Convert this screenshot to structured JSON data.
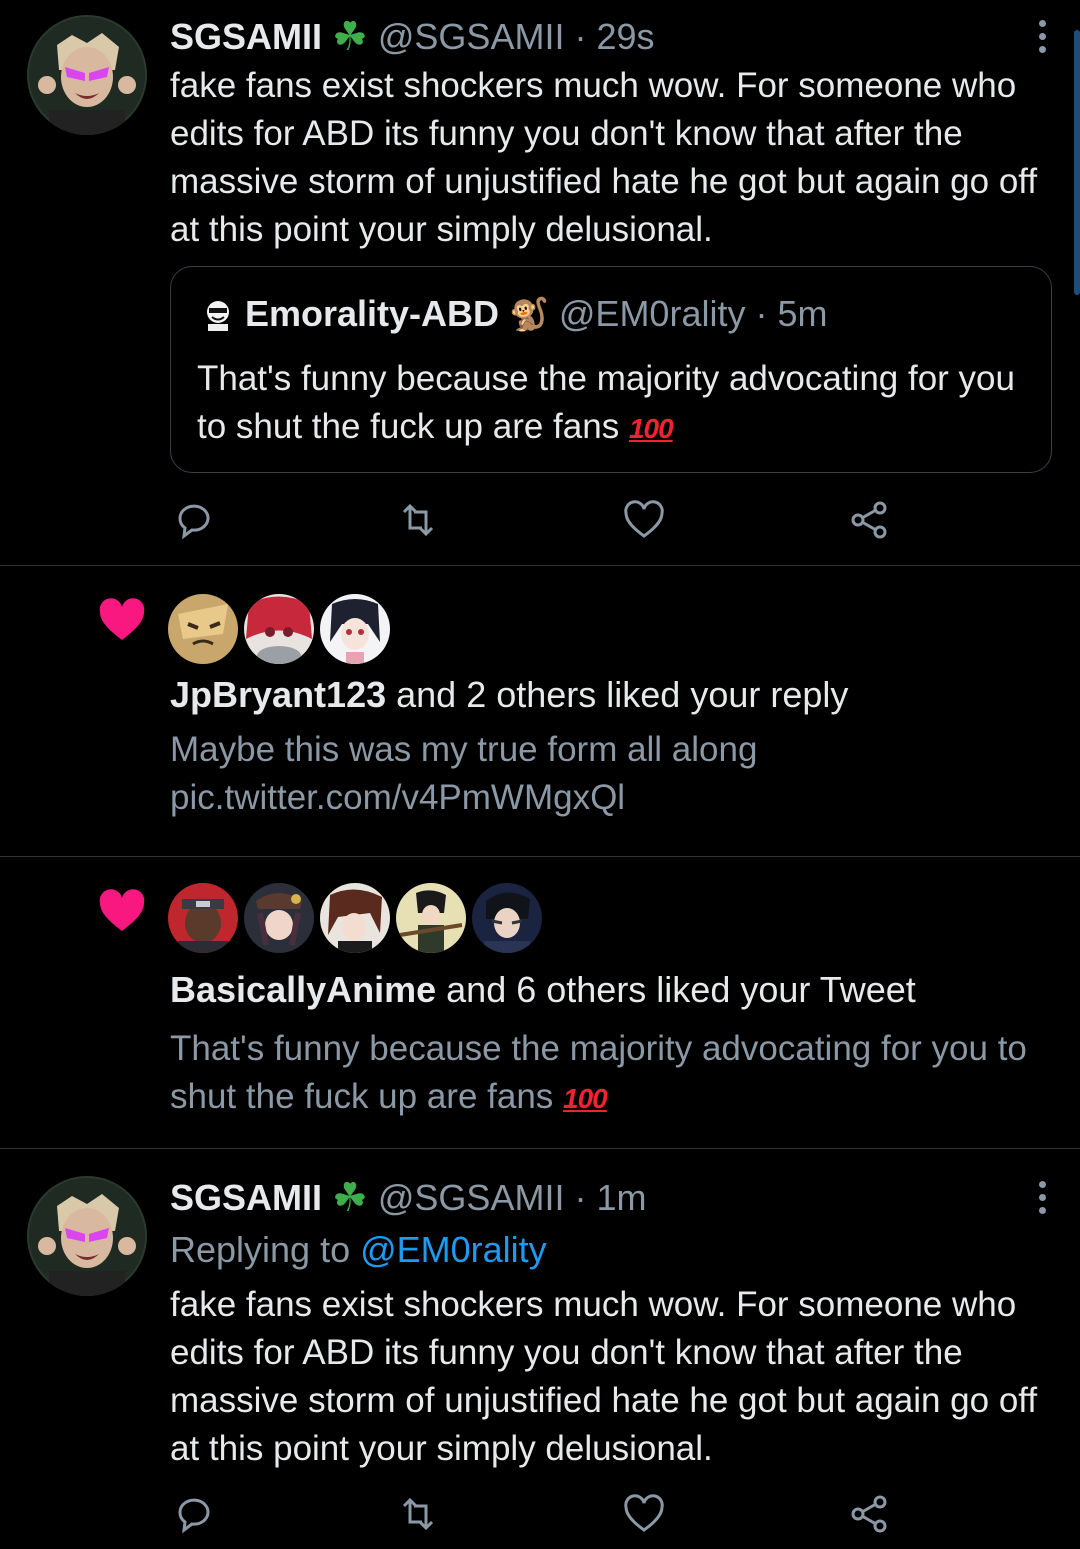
{
  "tweet1": {
    "display_name": "SGSAMII",
    "badge_emoji": "☘",
    "handle": "@SGSAMII",
    "time": "29s",
    "text": "fake fans exist shockers much wow. For someone who edits for ABD its funny you don't know that after the massive storm of unjustified hate he got but again go off at this point your simply delusional.",
    "quote": {
      "display_name": "Emorality-ABD",
      "badge_emoji": "🐒",
      "handle": "@EM0rality",
      "time": "5m",
      "text": "That's funny because the majority advocating for you to shut the fuck up are fans",
      "emoji": "100"
    }
  },
  "notif1": {
    "actor": "JpBryant123",
    "rest": "and 2 others liked your reply",
    "text_line1": "Maybe this was my true form all along",
    "text_line2": "pic.twitter.com/v4PmWMgxQl"
  },
  "notif2": {
    "actor": "BasicallyAnime",
    "rest": "and 6 others liked your Tweet",
    "text": "That's funny because the majority advocating for you to shut the fuck up are fans",
    "emoji": "100"
  },
  "tweet2": {
    "display_name": "SGSAMII",
    "badge_emoji": "☘",
    "handle": "@SGSAMII",
    "time": "1m",
    "replying_prefix": "Replying to",
    "replying_handle": "@EM0rality",
    "text": "fake fans exist shockers much wow. For someone who edits for ABD its funny you don't know that after the massive storm of unjustified hate he got but again go off at this point your simply delusional."
  },
  "icons": {
    "reply": "reply-icon",
    "retweet": "retweet-icon",
    "like": "like-icon",
    "share": "share-icon",
    "more": "more-icon"
  },
  "colors": {
    "background": "#000000",
    "link": "#1d9bf0",
    "heart": "#f91880",
    "muted": "#8b98a5"
  }
}
